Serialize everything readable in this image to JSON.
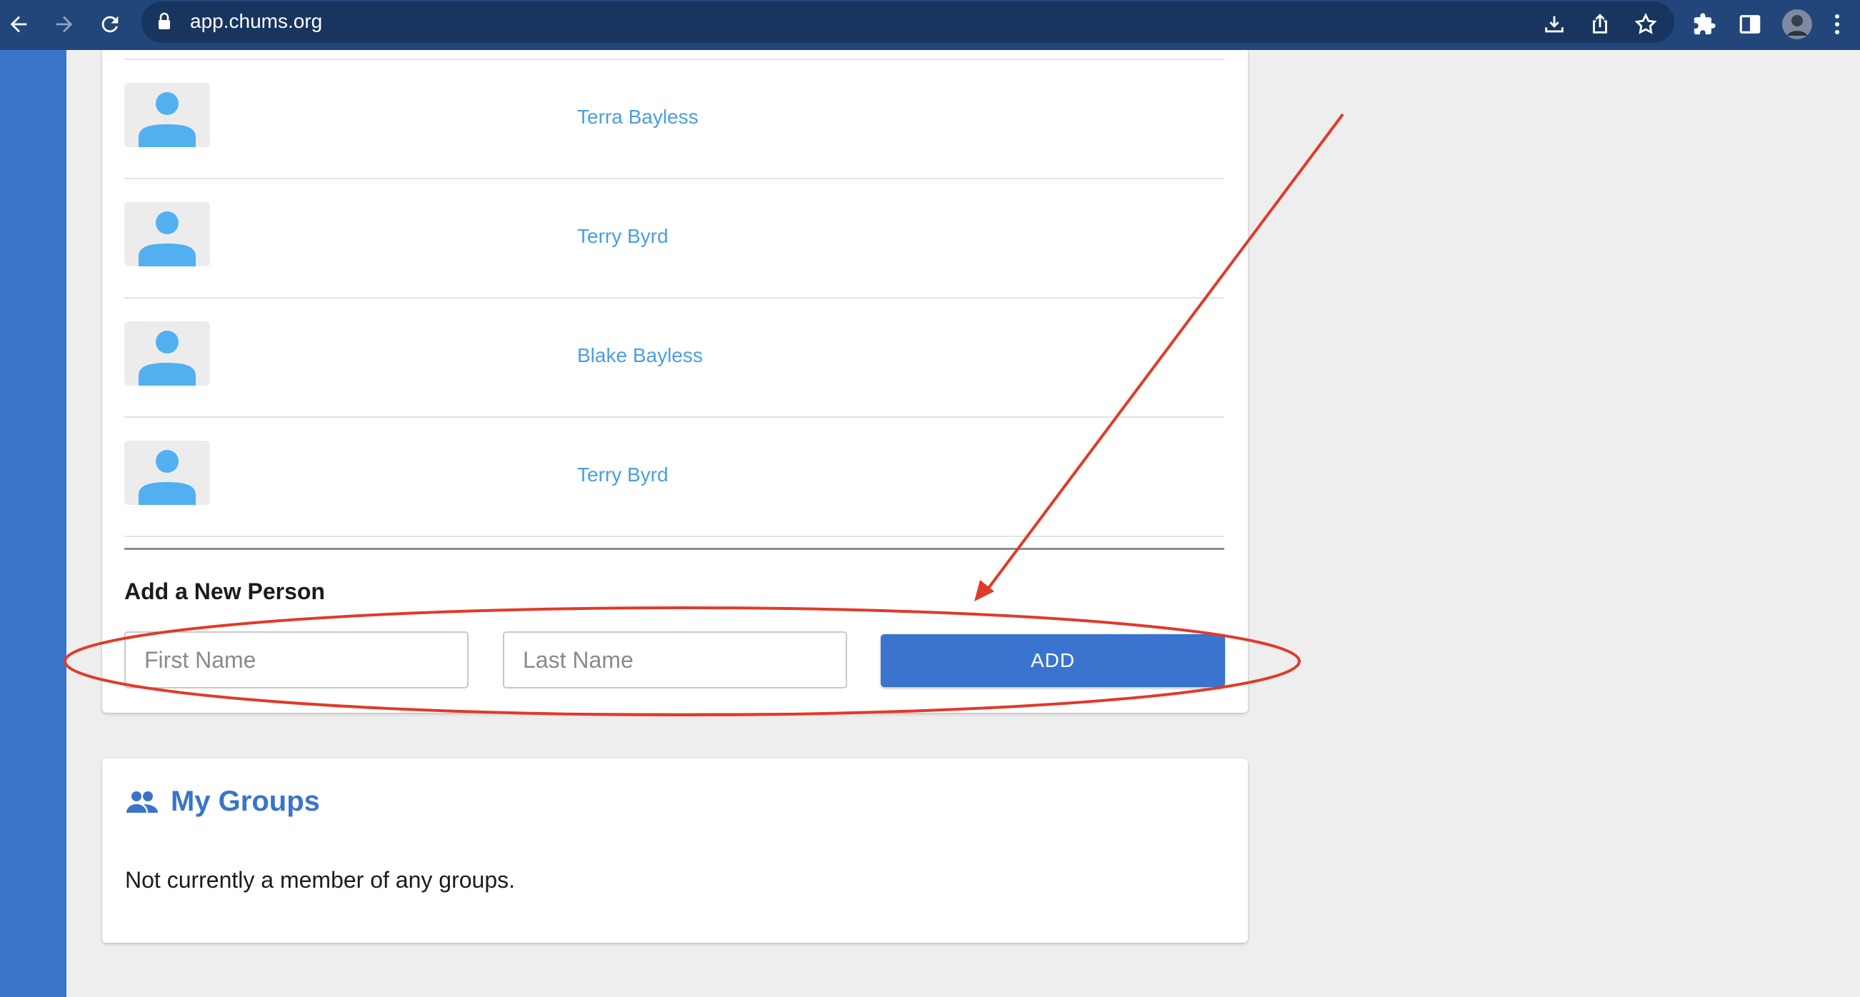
{
  "browser": {
    "url": "app.chums.org",
    "icons": [
      "back-arrow-icon",
      "forward-arrow-icon",
      "reload-icon",
      "lock-icon",
      "download-icon",
      "share-icon",
      "star-icon",
      "extensions-icon",
      "side-panel-icon",
      "profile-avatar",
      "menu-dots-icon"
    ]
  },
  "household": {
    "members": [
      {
        "name": "Terra Bayless"
      },
      {
        "name": "Terry Byrd"
      },
      {
        "name": "Blake Bayless"
      },
      {
        "name": "Terry Byrd"
      }
    ],
    "add_section": {
      "title": "Add a New Person",
      "first_name_placeholder": "First Name",
      "last_name_placeholder": "Last Name",
      "add_label": "ADD"
    }
  },
  "groups": {
    "title": "My Groups",
    "empty_text": "Not currently a member of any groups."
  },
  "colors": {
    "browser_bar": "#22467a",
    "side_strip": "#3a74c9",
    "link": "#4a9ee3",
    "avatar_icon": "#52b0f0",
    "primary_button": "#3a74cf",
    "annotation": "#e03a2a"
  }
}
